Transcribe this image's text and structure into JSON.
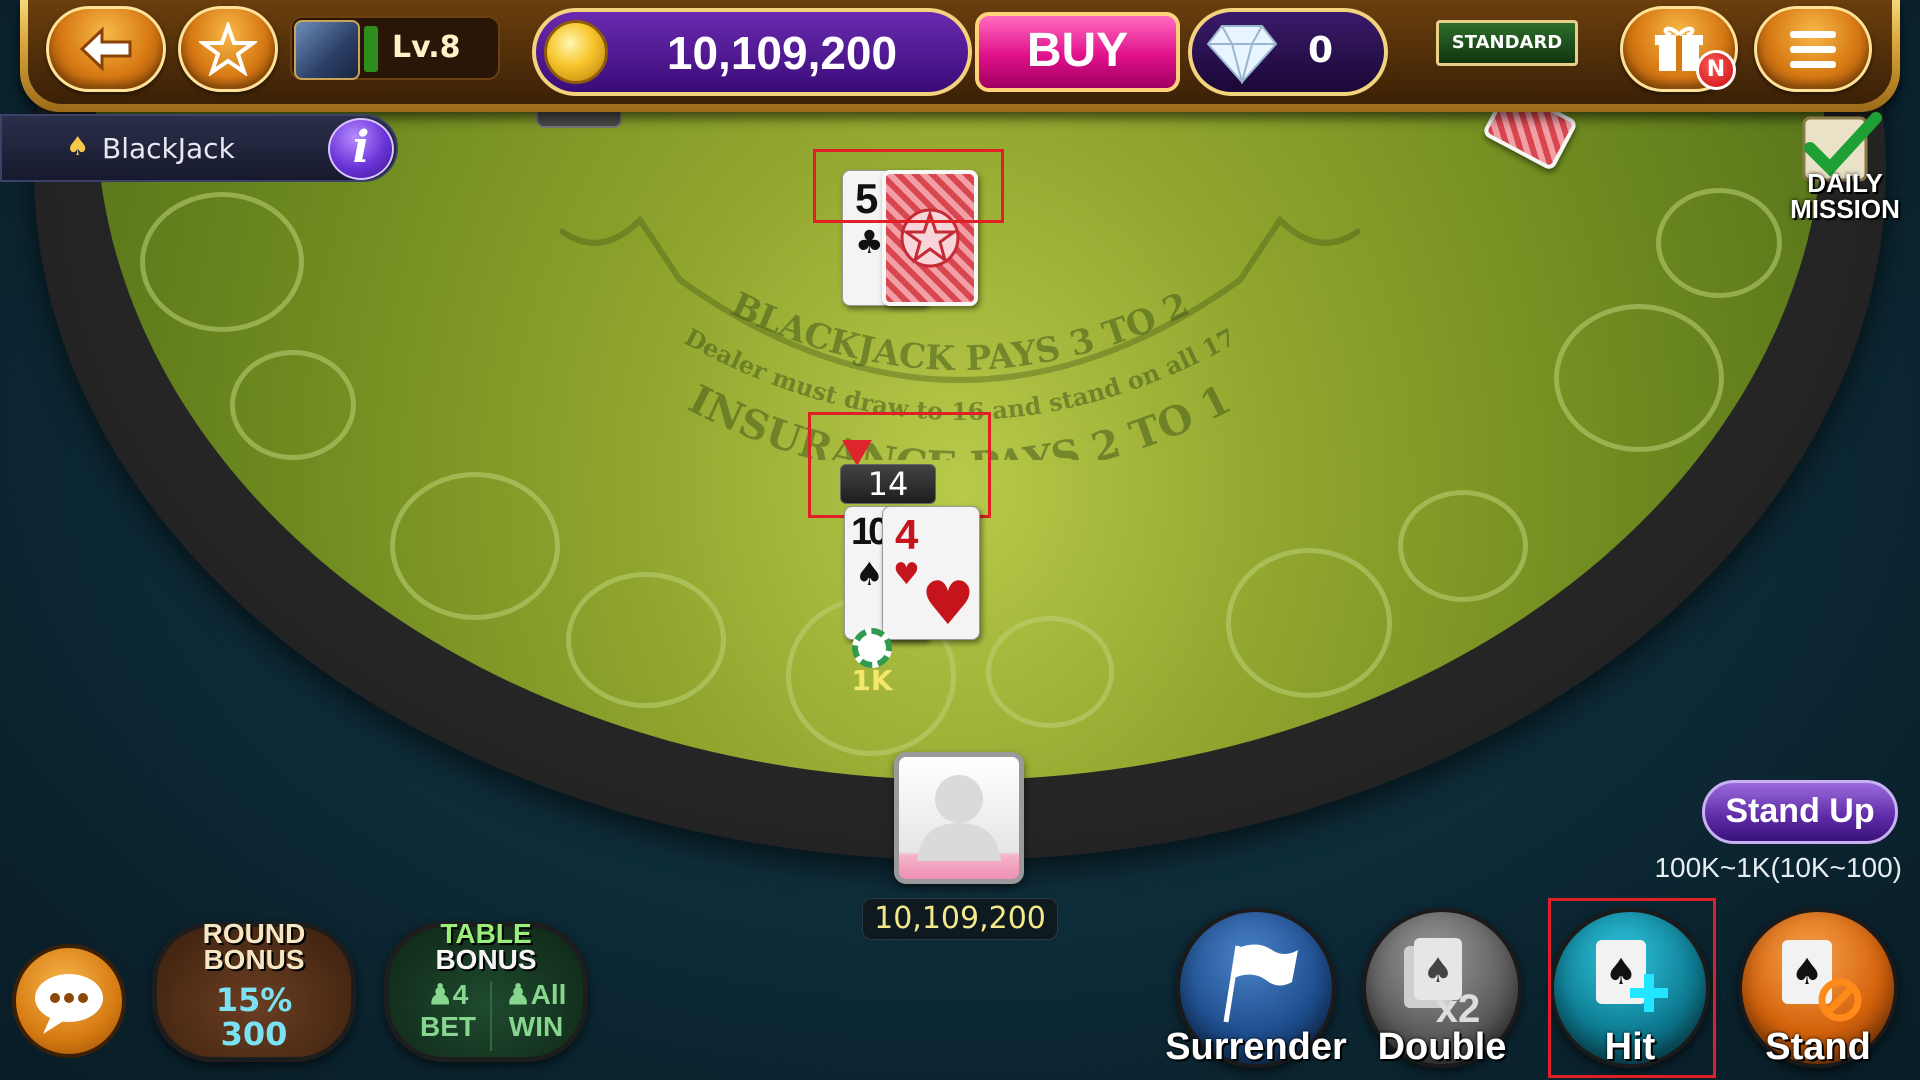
{
  "header": {
    "level": "Lv.8",
    "coins": "10,109,200",
    "buy_label": "BUY",
    "gems": "0",
    "room_type": "STANDARD",
    "notification_badge": "N"
  },
  "table": {
    "game_name": "BlackJack",
    "info_label": "i",
    "felt_line1": "BLACKJACK PAYS 3 TO 2",
    "felt_line2": "Dealer must draw to 16 and stand on all 17",
    "felt_line3": "INSURANCE PAYS 2 TO 1"
  },
  "daily_mission": {
    "label_line1": "DAILY",
    "label_line2": "MISSION"
  },
  "dealer": {
    "cards": [
      {
        "rank": "5",
        "suit": "clubs",
        "face_up": true
      },
      {
        "rank": "",
        "suit": "",
        "face_up": false
      }
    ]
  },
  "player": {
    "hand_total": "14",
    "cards": [
      {
        "rank": "10",
        "suit": "spades",
        "face_up": true
      },
      {
        "rank": "4",
        "suit": "hearts",
        "face_up": true
      }
    ],
    "bet": "1K",
    "balance": "10,109,200"
  },
  "controls": {
    "stand_up_label": "Stand Up",
    "bet_range": "100K~1K(10K~100)",
    "actions": [
      {
        "label": "Surrender",
        "icon": "flag-icon",
        "color": "#1f4f8f"
      },
      {
        "label": "Double",
        "icon": "double-icon",
        "color": "#6a6a6a"
      },
      {
        "label": "Hit",
        "icon": "hit-icon",
        "color": "#0e7c93",
        "highlighted": true
      },
      {
        "label": "Stand",
        "icon": "stand-icon",
        "color": "#d3620c"
      }
    ]
  },
  "bonuses": {
    "round": {
      "title_line1": "ROUND",
      "title_line2": "BONUS",
      "percent": "15%",
      "value": "300"
    },
    "table": {
      "title_line1": "TABLE",
      "title_line2": "BONUS",
      "left_count": "4",
      "left_label": "BET",
      "right_count": "All",
      "right_label": "WIN"
    }
  },
  "colors": {
    "felt": "#7a9427",
    "highlight_frame": "#e01f26",
    "coin_panel": "#4a1894",
    "buy_button": "#e0108a"
  }
}
